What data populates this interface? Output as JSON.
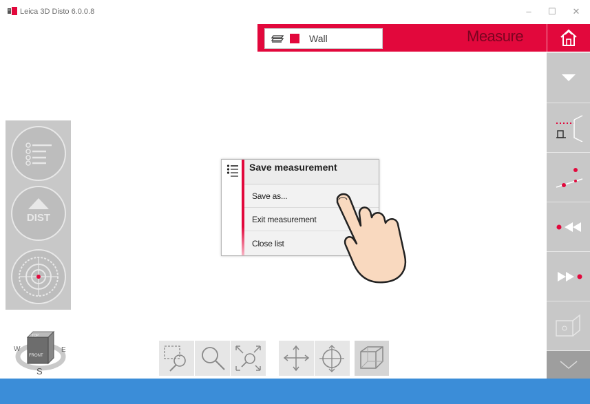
{
  "window": {
    "title": "Leica 3D Disto 6.0.0.8",
    "minimize_glyph": "–",
    "maximize_glyph": "☐",
    "close_glyph": "✕"
  },
  "top_bar": {
    "layer_name": "Wall",
    "mode_title": "Measure",
    "layer_color": "#e2083c"
  },
  "popup": {
    "title": "Save measurement",
    "items": [
      {
        "label": "Save as..."
      },
      {
        "label": "Exit measurement"
      },
      {
        "label": "Close list"
      }
    ]
  },
  "left_panel": {
    "dist_label": "DIST"
  },
  "compass": {
    "west": "W",
    "east": "E",
    "south": "S",
    "cube_top": "TOP",
    "cube_front": "FRONT"
  },
  "icons": {
    "home": "home-icon",
    "dropdown": "chevron-down-icon",
    "layers": "layers-icon",
    "list": "list-icon"
  },
  "colors": {
    "accent": "#e2083c",
    "status_bar": "#3b8dd8",
    "toolbar_grey": "#c8c8c8"
  }
}
